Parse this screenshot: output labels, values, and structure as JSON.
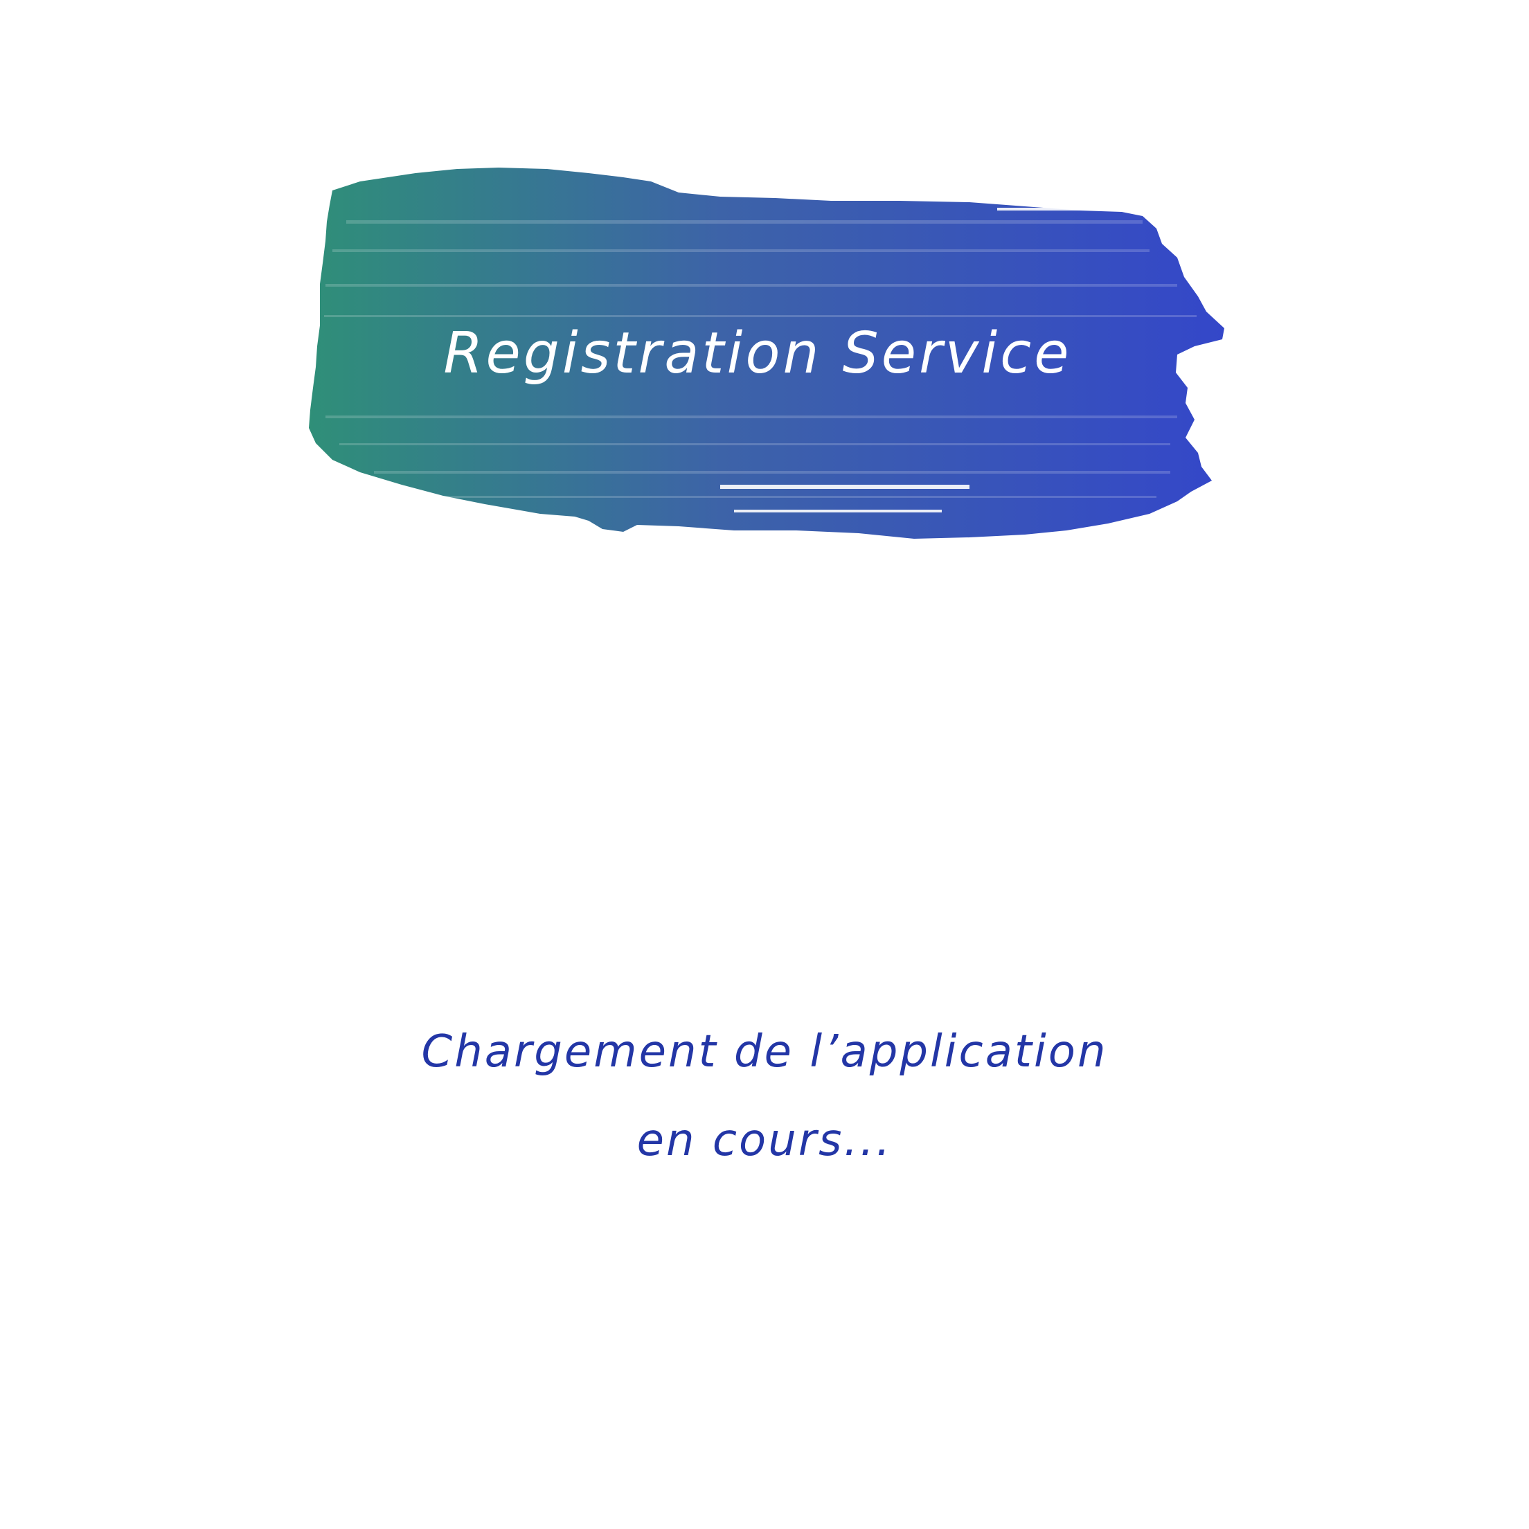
{
  "splash": {
    "title": "Registration Service",
    "loading_line1": "Chargement de l’application",
    "loading_line2": "en cours..."
  },
  "colors": {
    "background": "#ffffff",
    "brush_start": "#2f8f78",
    "brush_mid": "#3d63a8",
    "brush_end": "#3447c9",
    "title_text": "#ffffff",
    "loading_text": "#2336a6"
  },
  "icons": {
    "brush_stroke": "paint-brush-stroke-icon"
  }
}
